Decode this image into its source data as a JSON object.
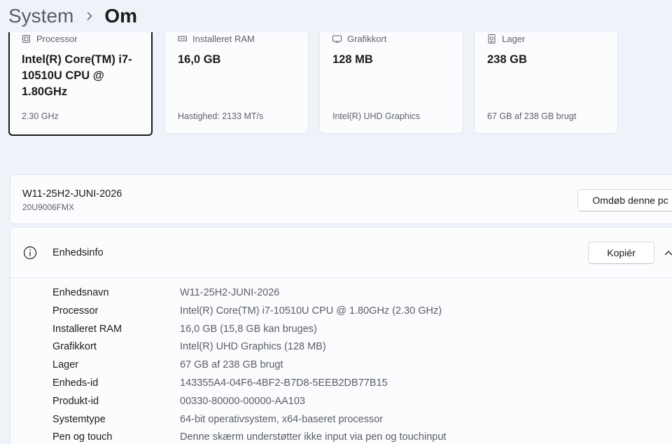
{
  "breadcrumb": {
    "parent": "System",
    "current": "Om"
  },
  "cards": [
    {
      "label": "Processor",
      "value": "Intel(R) Core(TM) i7-10510U CPU @ 1.80GHz",
      "sub": "2.30 GHz",
      "icon": "processor-icon"
    },
    {
      "label": "Installeret RAM",
      "value": "16,0 GB",
      "sub": "Hastighed: 2133 MT/s",
      "icon": "memory-icon"
    },
    {
      "label": "Grafikkort",
      "value": "128 MB",
      "sub": "Intel(R) UHD Graphics",
      "icon": "display-icon"
    },
    {
      "label": "Lager",
      "value": "238 GB",
      "sub": "67 GB af 238 GB brugt",
      "icon": "storage-icon"
    }
  ],
  "pc": {
    "name": "W11-25H2-JUNI-2026",
    "model": "20U9006FMX",
    "rename_label": "Omdøb denne pc"
  },
  "device_info": {
    "title": "Enhedsinfo",
    "copy_label": "Kopiér",
    "rows": [
      {
        "key": "Enhedsnavn",
        "value": "W11-25H2-JUNI-2026"
      },
      {
        "key": "Processor",
        "value": "Intel(R) Core(TM) i7-10510U CPU @ 1.80GHz (2.30 GHz)"
      },
      {
        "key": "Installeret RAM",
        "value": "16,0 GB (15,8 GB kan bruges)"
      },
      {
        "key": "Grafikkort",
        "value": "Intel(R) UHD Graphics (128 MB)"
      },
      {
        "key": "Lager",
        "value": "67 GB af 238 GB brugt"
      },
      {
        "key": "Enheds-id",
        "value": "143355A4-04F6-4BF2-B7D8-5EEB2DB77B15"
      },
      {
        "key": "Produkt-id",
        "value": "00330-80000-00000-AA103"
      },
      {
        "key": "Systemtype",
        "value": "64-bit operativsystem, x64-baseret processor"
      },
      {
        "key": "Pen og touch",
        "value": "Denne skærm understøtter ikke input via pen og touchinput"
      }
    ]
  },
  "colors": {
    "accent_border": "#1b1b1b",
    "card_bg": "#fbfcfe",
    "page_bg": "#eef2f9"
  }
}
